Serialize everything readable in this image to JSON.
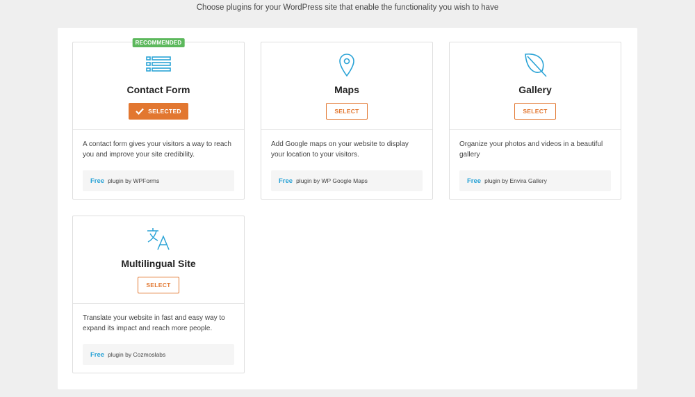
{
  "page": {
    "subtitle": "Choose plugins for your WordPress site that enable the functionality you wish to have"
  },
  "colors": {
    "accent": "#e27730",
    "badge": "#5cb85c",
    "icon": "#2aa3d6",
    "free_text": "#2aa3d6"
  },
  "cards": [
    {
      "icon": "form-list-icon",
      "badge": "RECOMMENDED",
      "title": "Contact Form",
      "button_label": "SELECTED",
      "selected": true,
      "description": "A contact form gives your visitors a way to reach you and improve your site credibility.",
      "free_label": "Free",
      "plugin_by": "plugin by WPForms"
    },
    {
      "icon": "map-pin-icon",
      "title": "Maps",
      "button_label": "SELECT",
      "selected": false,
      "description": "Add Google maps on your website to display your location to your visitors.",
      "free_label": "Free",
      "plugin_by": "plugin by WP Google Maps"
    },
    {
      "icon": "leaf-icon",
      "title": "Gallery",
      "button_label": "SELECT",
      "selected": false,
      "description": "Organize your photos and videos in a beautiful gallery",
      "free_label": "Free",
      "plugin_by": "plugin by Envira Gallery"
    },
    {
      "icon": "translate-icon",
      "title": "Multilingual Site",
      "button_label": "SELECT",
      "selected": false,
      "description": "Translate your website in fast and easy way to expand its impact and reach more people.",
      "free_label": "Free",
      "plugin_by": "plugin by Cozmoslabs"
    }
  ]
}
